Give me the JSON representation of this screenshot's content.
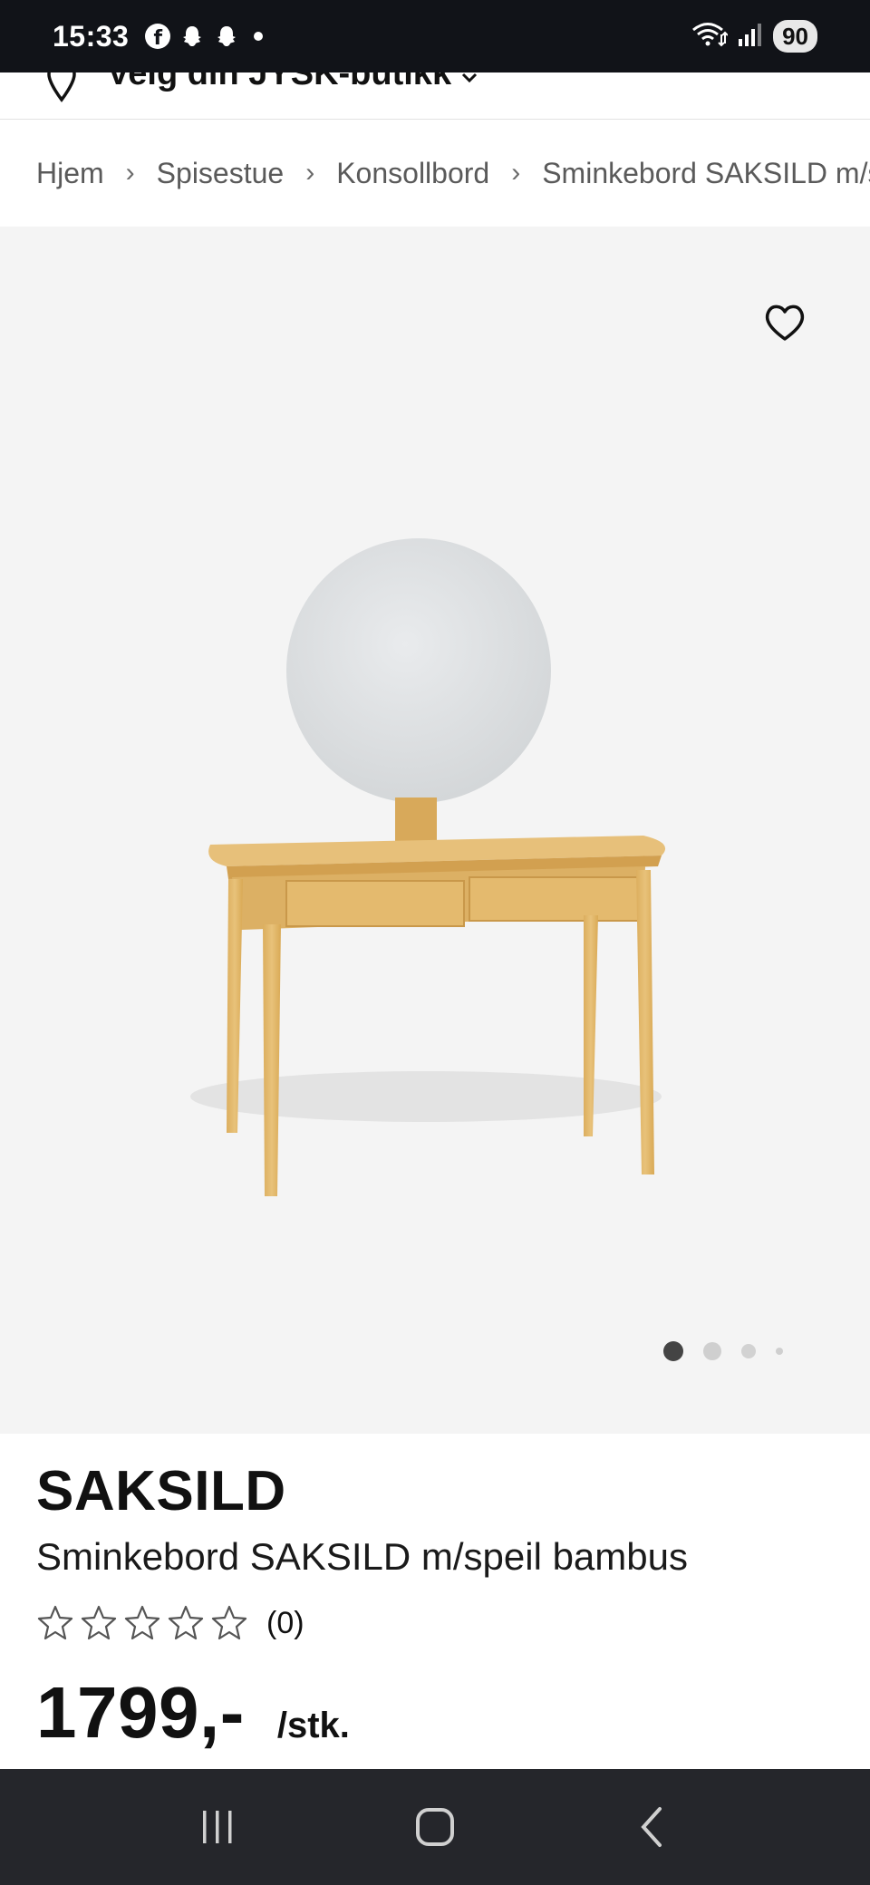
{
  "status_bar": {
    "time": "15:33",
    "fb_glyph": "f",
    "battery": "90"
  },
  "store_selector": {
    "label": "Velg din JYSK-butikk"
  },
  "breadcrumb": {
    "items": [
      "Hjem",
      "Spisestue",
      "Konsollbord",
      "Sminkebord SAKSILD m/speil bambus"
    ],
    "separator": "›"
  },
  "gallery": {
    "image_count": 4,
    "active_index": 0
  },
  "product": {
    "brand": "SAKSILD",
    "name": "Sminkebord SAKSILD m/speil bambus",
    "rating_stars_filled": 0,
    "rating_stars_total": 5,
    "rating_count": "(0)",
    "price": "1799,-",
    "unit": "/stk."
  },
  "colors": {
    "status_bar_bg": "#111318",
    "gallery_bg": "#f4f4f4",
    "nav_bar_bg": "#25262b",
    "wood": "#e2b96a",
    "mirror": "#dfe1e3"
  }
}
